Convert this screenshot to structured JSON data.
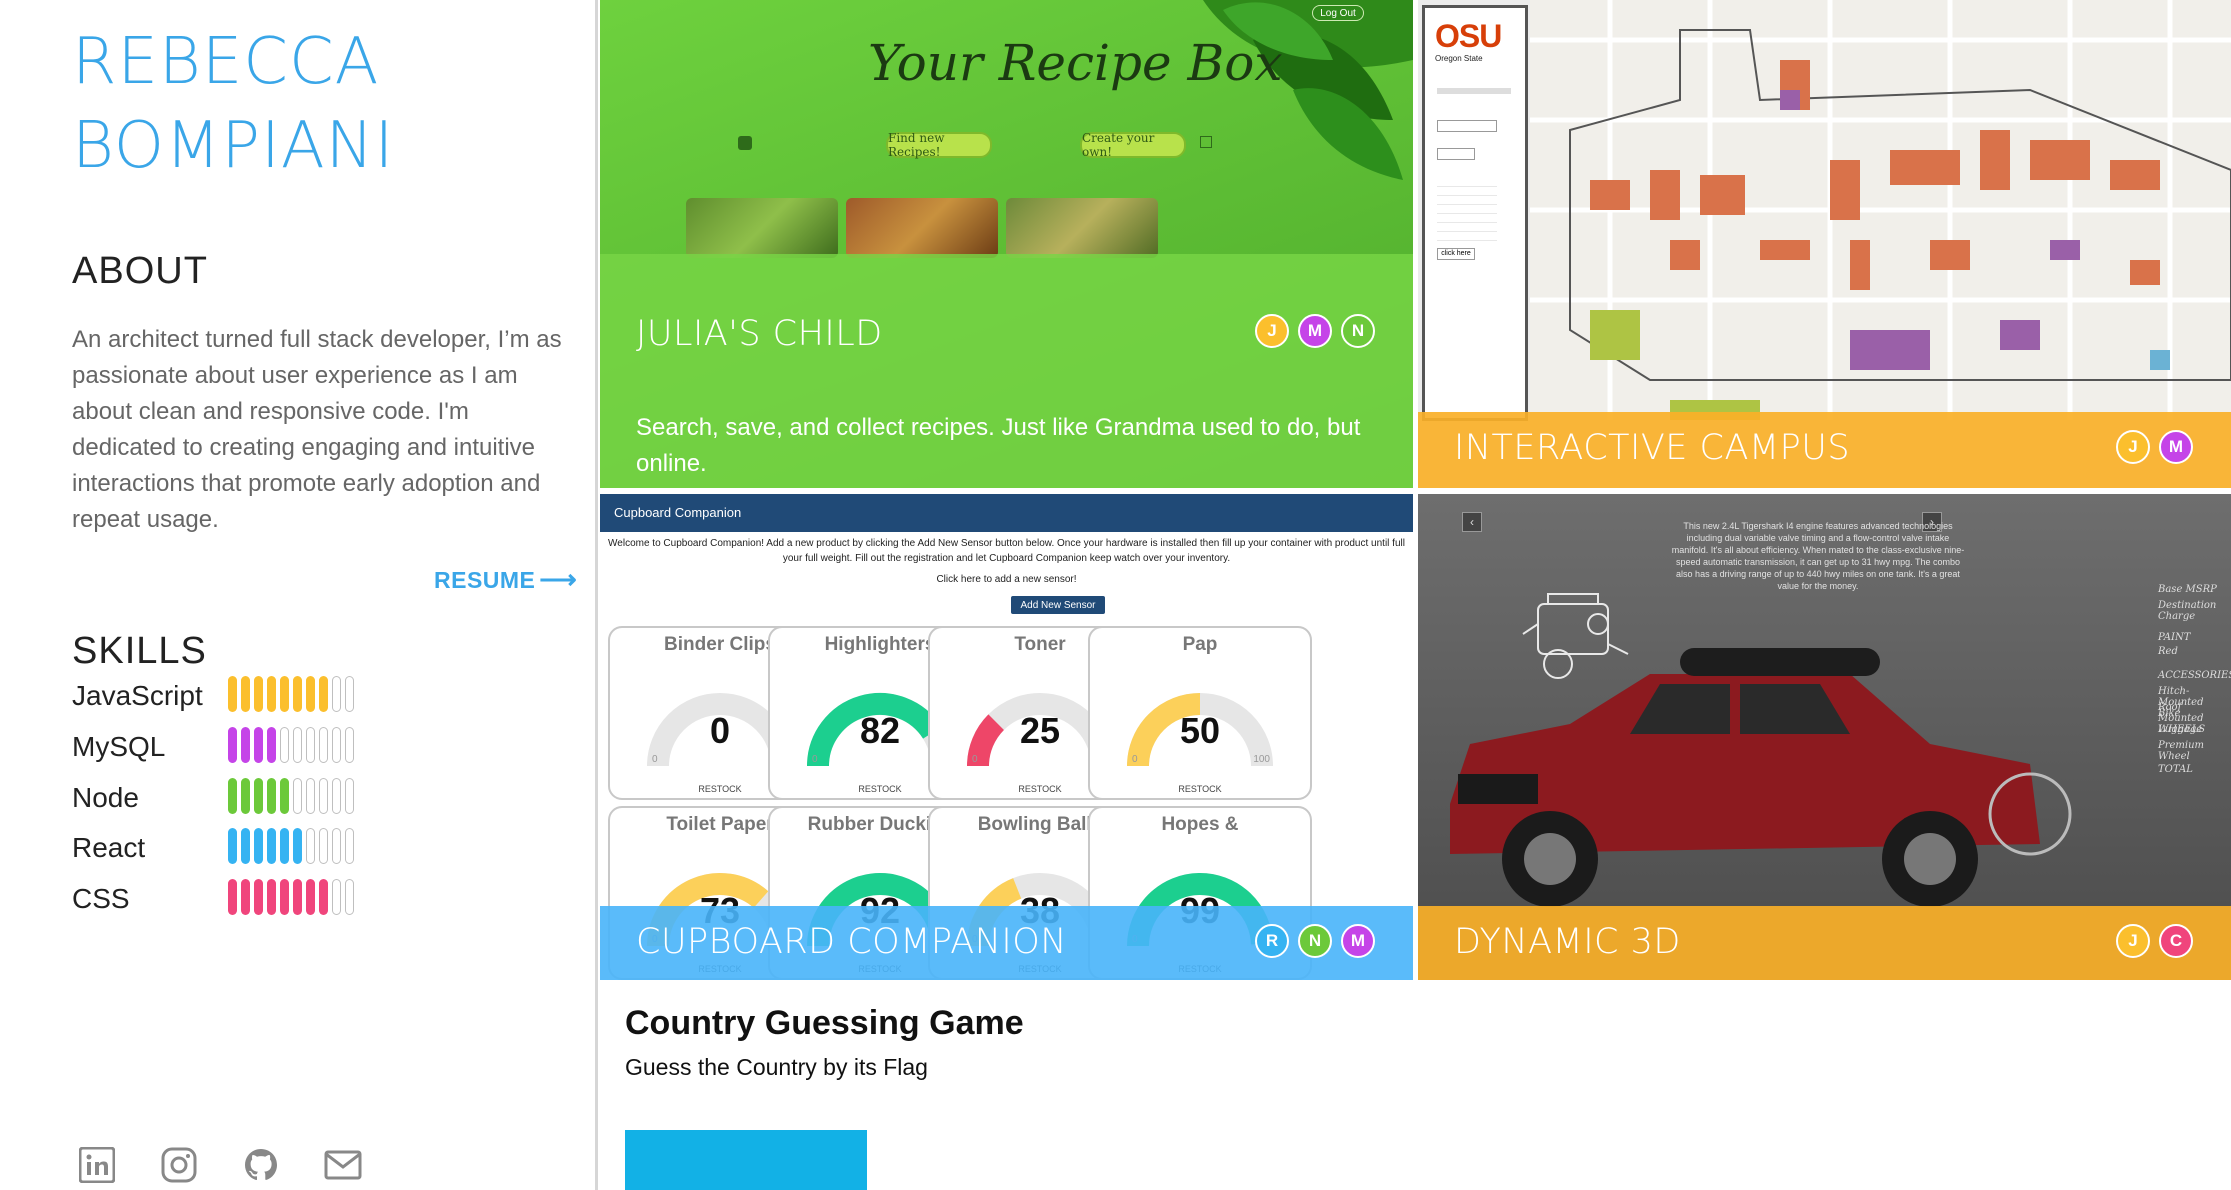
{
  "profile": {
    "name_line1": "REBECCA",
    "name_line2": "BOMPIANI"
  },
  "about": {
    "heading": "ABOUT",
    "text": "An architect turned full stack developer, I’m as passionate about user experience as I am about clean and responsive code. I'm dedicated to creating engaging and intuitive interactions that promote early adoption and repeat usage.",
    "resume_label": "RESUME",
    "resume_arrow": "⟶"
  },
  "skills": {
    "heading": "SKILLS",
    "items": [
      {
        "name": "JavaScript",
        "level": 0.8,
        "color": "#fbbf2d"
      },
      {
        "name": "MySQL",
        "level": 0.4,
        "color": "#c544e8"
      },
      {
        "name": "Node",
        "level": 0.5,
        "color": "#6cc93a"
      },
      {
        "name": "React",
        "level": 0.6,
        "color": "#35b3f2"
      },
      {
        "name": "CSS",
        "level": 0.8,
        "color": "#f0457c"
      }
    ]
  },
  "social": [
    {
      "name": "linkedin-icon"
    },
    {
      "name": "instagram-icon"
    },
    {
      "name": "github-icon"
    },
    {
      "name": "mail-icon"
    }
  ],
  "projects": {
    "julias_child": {
      "title": "JULIA'S CHILD",
      "description": "Search, save, and collect recipes. Just like Grandma used to do, but online.",
      "screenshot_title": "Your Recipe Box",
      "btn_find": "Find new Recipes!",
      "btn_create": "Create your own!",
      "logout": "Log Out",
      "badges": [
        {
          "letter": "J",
          "color": "#fbbf2d"
        },
        {
          "letter": "M",
          "color": "#c544e8"
        },
        {
          "letter": "N",
          "color": "#6cc93a"
        }
      ]
    },
    "interactive_campus": {
      "title": "INTERACTIVE CAMPUS",
      "osu_logo": "OSU",
      "osu_sub": "Oregon State",
      "panel_button": "click here",
      "badges": [
        {
          "letter": "J",
          "color": "#fbbf2d"
        },
        {
          "letter": "M",
          "color": "#c544e8"
        }
      ]
    },
    "cupboard_companion": {
      "title": "CUPBOARD COMPANION",
      "header": "Cupboard Companion",
      "intro": "Welcome to Cupboard Companion! Add a new product by clicking the Add New Sensor button below. Once your hardware is installed then fill up your container with product until full your full weight. Fill out the registration and let Cupboard Companion keep watch over your inventory.",
      "click_text": "Click here to add a new sensor!",
      "button": "Add New Sensor",
      "gauge_min": "0",
      "gauge_max": "100",
      "restock": "RESTOCK",
      "gauges": [
        {
          "name": "Binder Clips",
          "value": "0",
          "level": 0,
          "color": "#e0e0e0"
        },
        {
          "name": "Highlighters",
          "value": "82",
          "level": 0.82,
          "color": "#1ccf8f"
        },
        {
          "name": "Toner",
          "value": "25",
          "level": 0.25,
          "color": "#ee4668"
        },
        {
          "name": "Pap",
          "value": "50",
          "level": 0.5,
          "color": "#fcd05a"
        },
        {
          "name": "Toilet Paper",
          "value": "73",
          "level": 0.73,
          "color": "#fcd05a"
        },
        {
          "name": "Rubber Duckies",
          "value": "92",
          "level": 0.92,
          "color": "#1ccf8f"
        },
        {
          "name": "Bowling Balls",
          "value": "38",
          "level": 0.38,
          "color": "#fcd05a"
        },
        {
          "name": "Hopes &",
          "value": "99",
          "level": 0.99,
          "color": "#1ccf8f"
        }
      ],
      "badges": [
        {
          "letter": "R",
          "color": "#35b3f2"
        },
        {
          "letter": "N",
          "color": "#6cc93a"
        },
        {
          "letter": "M",
          "color": "#c544e8"
        }
      ]
    },
    "dynamic_3d": {
      "title": "DYNAMIC 3D",
      "car_text": "This new 2.4L Tigershark I4 engine features advanced technologies including dual variable valve timing and a flow-control valve intake manifold. It's all about efficiency. When mated to the class-exclusive nine-speed automatic transmission, it can get up to 31 hwy mpg. The combo also has a driving range of up to 440 hwy miles on one tank. It's a great value for the money.",
      "specs": [
        "Base MSRP",
        "Destination Charge",
        "PAINT",
        "Red",
        "ACCESSORIES",
        "Hitch-Mounted Bike",
        "Roof Mounted Luggage",
        "WHEELS",
        "Premium Wheel",
        "TOTAL"
      ],
      "badges": [
        {
          "letter": "J",
          "color": "#fbbf2d"
        },
        {
          "letter": "C",
          "color": "#f0457c"
        }
      ]
    }
  },
  "country_game": {
    "title": "Country Guessing Game",
    "subtitle": "Guess the Country by its Flag"
  }
}
